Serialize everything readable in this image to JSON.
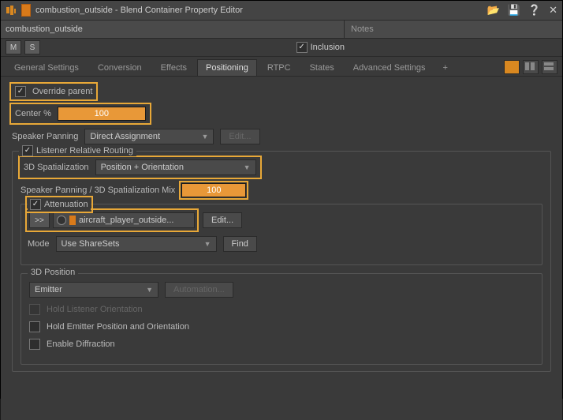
{
  "titlebar": {
    "title": "combustion_outside - Blend Container Property Editor"
  },
  "object": {
    "name": "combustion_outside",
    "notes_label": "Notes"
  },
  "msbar": {
    "m": "M",
    "s": "S",
    "inclusion": "Inclusion"
  },
  "tabs": [
    "General Settings",
    "Conversion",
    "Effects",
    "Positioning",
    "RTPC",
    "States",
    "Advanced Settings",
    "+"
  ],
  "positioning": {
    "override_parent": "Override parent",
    "center_label": "Center %",
    "center_value": "100",
    "speaker_panning_label": "Speaker Panning",
    "speaker_panning_value": "Direct Assignment",
    "edit_label": "Edit...",
    "listener_relative": "Listener Relative Routing",
    "spatialization_label": "3D Spatialization",
    "spatialization_value": "Position + Orientation",
    "mix_label": "Speaker Panning / 3D Spatialization Mix",
    "mix_value": "100",
    "attenuation_label": "Attenuation",
    "att_nav": ">>",
    "att_name": "aircraft_player_outside...",
    "mode_label": "Mode",
    "mode_value": "Use ShareSets",
    "find_label": "Find",
    "pos3d_title": "3D Position",
    "pos3d_value": "Emitter",
    "automation_label": "Automation...",
    "hold_listener": "Hold Listener Orientation",
    "hold_emitter": "Hold Emitter Position and Orientation",
    "enable_diffraction": "Enable Diffraction"
  }
}
